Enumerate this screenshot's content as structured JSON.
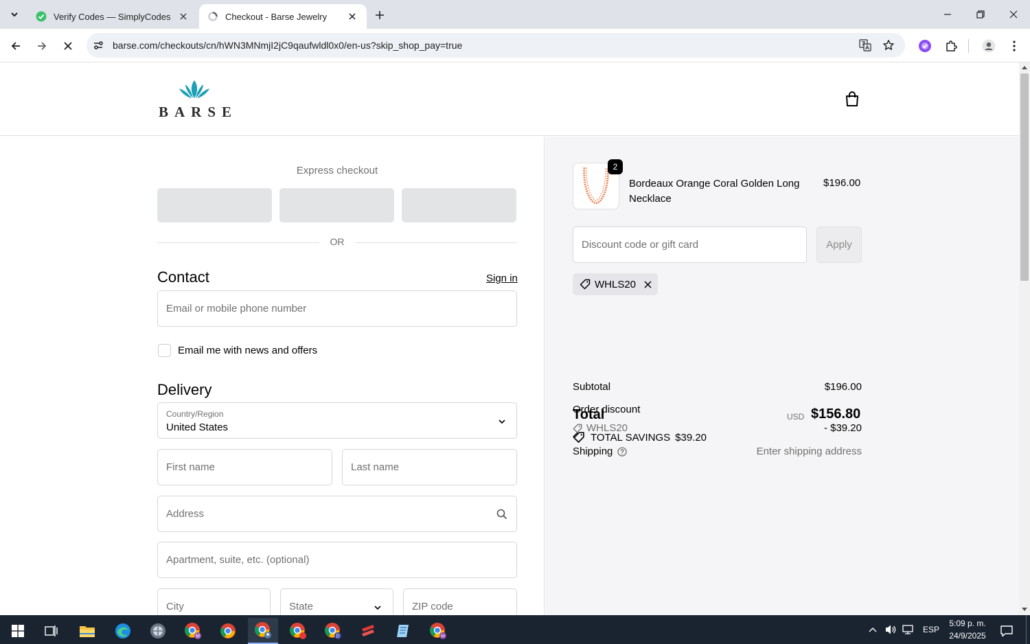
{
  "browser": {
    "tabs": [
      {
        "title": "Verify Codes — SimplyCodes",
        "active": false
      },
      {
        "title": "Checkout - Barse Jewelry",
        "active": true
      }
    ],
    "url": "barse.com/checkouts/cn/hWN3MNmjI2jC9qaufwldl0x0/en-us?skip_shop_pay=true"
  },
  "brand": {
    "logo_text": "BARSE",
    "accent": "#1e9fb5"
  },
  "checkout": {
    "express_label": "Express checkout",
    "or_label": "OR",
    "contact": {
      "heading": "Contact",
      "signin": "Sign in",
      "email_placeholder": "Email or mobile phone number",
      "newsletter_label": "Email me with news and offers"
    },
    "delivery": {
      "heading": "Delivery",
      "country_label": "Country/Region",
      "country_value": "United States",
      "first_name": "First name",
      "last_name": "Last name",
      "address": "Address",
      "apartment": "Apartment, suite, etc. (optional)",
      "city": "City",
      "state": "State",
      "zip": "ZIP code"
    }
  },
  "summary": {
    "product": {
      "name": "Bordeaux Orange Coral Golden Long Necklace",
      "price": "$196.00",
      "quantity": "2"
    },
    "discount_placeholder": "Discount code or gift card",
    "apply_label": "Apply",
    "applied_code": "WHLS20",
    "subtotal_label": "Subtotal",
    "subtotal_value": "$196.00",
    "order_discount_label": "Order discount",
    "discount_code": "WHLS20",
    "discount_value": "- $39.20",
    "shipping_label": "Shipping",
    "shipping_value": "Enter shipping address",
    "total_label": "Total",
    "currency": "USD",
    "total_value": "$156.80",
    "savings_label": "TOTAL SAVINGS",
    "savings_value": "$39.20"
  },
  "system": {
    "language": "ESP",
    "time": "5:09 p. m.",
    "date": "24/9/2025"
  }
}
